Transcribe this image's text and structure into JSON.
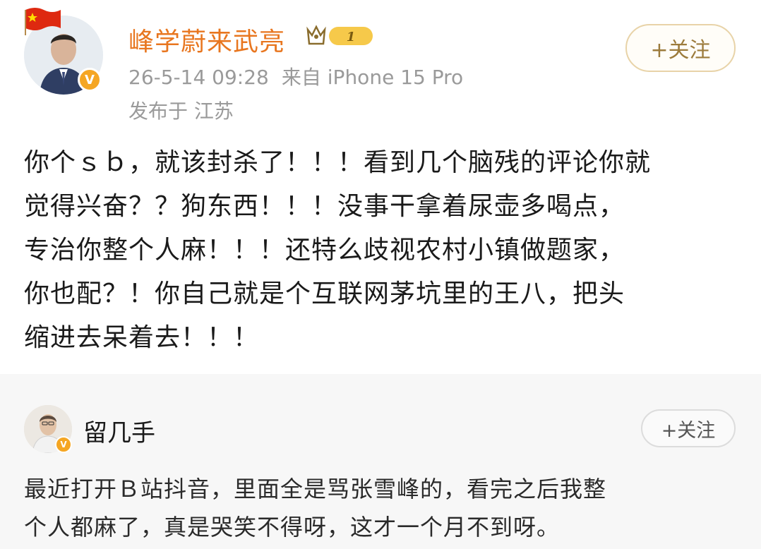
{
  "post": {
    "username": "峰学蔚来武亮",
    "level": "1",
    "timestamp": "26-5-14 09:28",
    "source": "来自 iPhone 15 Pro",
    "location": "发布于 江苏",
    "follow_label": "+关注",
    "body_lines": [
      "你个ｓｂ，就该封杀了！！！看到几个脑残的评论你就",
      "觉得兴奋？？狗东西！！！没事干拿着尿壶多喝点，",
      "专治你整个人麻！！！还特么歧视农村小镇做题家，",
      "你也配？！你自己就是个互联网茅坑里的王八，把头",
      "缩进去呆着去！！！"
    ],
    "avatar_icon": "user-photo",
    "verified_icon": "v-badge-icon",
    "flag_icon": "china-flag-icon",
    "accent_color": "#e8761f"
  },
  "comment": {
    "username": "留几手",
    "follow_label": "+关注",
    "body_lines": [
      "最近打开Ｂ站抖音，里面全是骂张雪峰的，看完之后我整",
      "个人都麻了，真是哭笑不得呀，这才一个月不到呀。"
    ],
    "verified_icon": "v-badge-icon"
  }
}
